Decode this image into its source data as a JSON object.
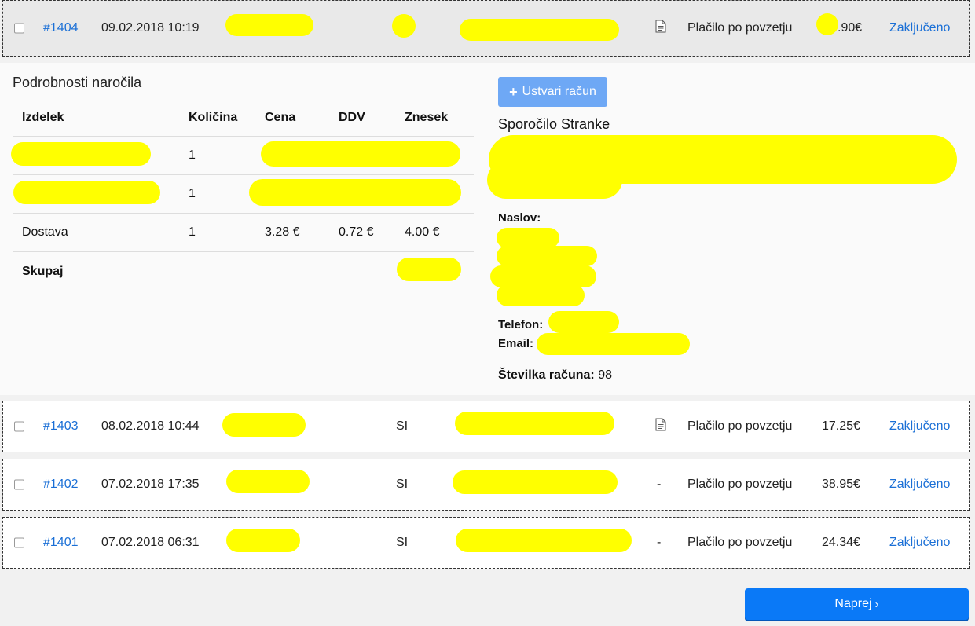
{
  "orders": [
    {
      "id": "#1404",
      "datetime": "09.02.2018 10:19",
      "country": "",
      "doc": true,
      "payment": "Plačilo po povzetju",
      "total": ".90€",
      "status": "Zaključeno"
    },
    {
      "id": "#1403",
      "datetime": "08.02.2018 10:44",
      "country": "SI",
      "doc": true,
      "payment": "Plačilo po povzetju",
      "total": "17.25€",
      "status": "Zaključeno"
    },
    {
      "id": "#1402",
      "datetime": "07.02.2018 17:35",
      "country": "SI",
      "doc": false,
      "doc_placeholder": "-",
      "payment": "Plačilo po povzetju",
      "total": "38.95€",
      "status": "Zaključeno"
    },
    {
      "id": "#1401",
      "datetime": "07.02.2018 06:31",
      "country": "SI",
      "doc": false,
      "doc_placeholder": "-",
      "payment": "Plačilo po povzetju",
      "total": "24.34€",
      "status": "Zaključeno"
    }
  ],
  "details": {
    "title": "Podrobnosti naročila",
    "columns": [
      "Izdelek",
      "Količina",
      "Cena",
      "DDV",
      "Znesek"
    ],
    "items": [
      {
        "product": "",
        "qty": "1",
        "price": "",
        "vat": "",
        "amount": ""
      },
      {
        "product": "",
        "qty": "1",
        "price": "",
        "vat": "",
        "amount": ""
      },
      {
        "product": "Dostava",
        "qty": "1",
        "price": "3.28 €",
        "vat": "0.72 €",
        "amount": "4.00 €"
      }
    ],
    "total_label": "Skupaj",
    "create_invoice_label": "Ustvari račun",
    "customer_message_title": "Sporočilo Stranke",
    "address_label": "Naslov:",
    "phone_label": "Telefon:",
    "email_label": "Email:",
    "invoice_number_label": "Številka računa:",
    "invoice_number": "98"
  },
  "pagination": {
    "next_label": "Naprej",
    "next_icon": "chevron-right-icon"
  },
  "colors": {
    "link": "#1a6fd6",
    "redaction": "#ffff00",
    "primary_button": "#0a79f7",
    "secondary_button": "#6ea8f5"
  }
}
